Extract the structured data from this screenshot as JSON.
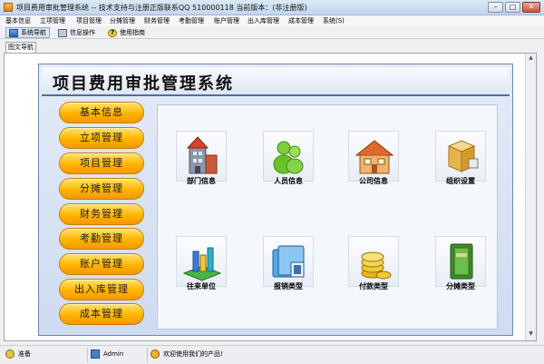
{
  "window": {
    "title": "项目费用审批管理系统 -- 技术支持与注册正版联系QQ 510000118    当前版本：(非注册版)"
  },
  "menu": [
    "基本信息",
    "立项管理",
    "项目管理",
    "分摊管理",
    "财务管理",
    "考勤管理",
    "账户管理",
    "出入库管理",
    "成本管理",
    "系统(S)"
  ],
  "toolbar": {
    "items": [
      {
        "label": "系统导航",
        "icon": "nav-icon"
      },
      {
        "label": "信息操作",
        "icon": "info-icon"
      },
      {
        "label": "使用指南",
        "icon": "help-icon"
      }
    ]
  },
  "doc_tab": "图文导航",
  "app": {
    "title": "项目费用审批管理系统"
  },
  "nav_buttons": [
    "基本信息",
    "立项管理",
    "项目管理",
    "分摊管理",
    "财务管理",
    "考勤管理",
    "账户管理",
    "出入库管理",
    "成本管理"
  ],
  "modules": [
    {
      "label": "部门信息",
      "icon": "department-building-icon"
    },
    {
      "label": "人员信息",
      "icon": "people-icon"
    },
    {
      "label": "公司信息",
      "icon": "company-house-icon"
    },
    {
      "label": "组织设置",
      "icon": "organization-icon"
    },
    {
      "label": "往来单位",
      "icon": "partner-units-icon"
    },
    {
      "label": "报销类型",
      "icon": "reimbursement-folder-icon"
    },
    {
      "label": "付款类型",
      "icon": "payment-coins-icon"
    },
    {
      "label": "分摊类型",
      "icon": "allocation-book-icon"
    }
  ],
  "status": {
    "state": "准备",
    "user": "Admin",
    "message": "欢迎使用我们的产品!"
  },
  "colors": {
    "nav_button": "#ffb300",
    "header_border": "#4e6da2",
    "titlebar": "#c3d6ee"
  }
}
